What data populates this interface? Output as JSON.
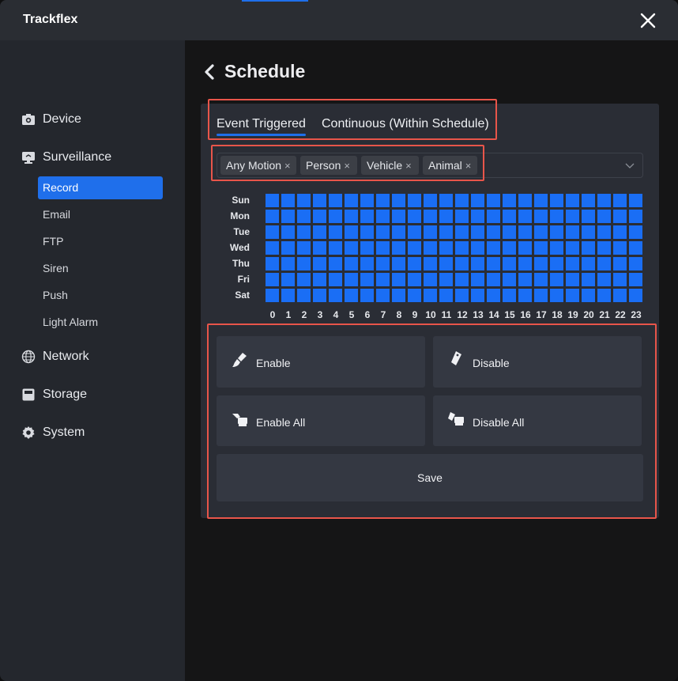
{
  "app": {
    "title": "Trackflex"
  },
  "sidebar": {
    "items": [
      {
        "label": "Device",
        "icon": "camera-icon"
      },
      {
        "label": "Surveillance",
        "icon": "monitor-icon"
      },
      {
        "label": "Network",
        "icon": "globe-icon"
      },
      {
        "label": "Storage",
        "icon": "storage-icon"
      },
      {
        "label": "System",
        "icon": "gear-icon"
      }
    ],
    "sub_items": [
      {
        "label": "Record",
        "active": true
      },
      {
        "label": "Email"
      },
      {
        "label": "FTP"
      },
      {
        "label": "Siren"
      },
      {
        "label": "Push"
      },
      {
        "label": "Light Alarm"
      }
    ]
  },
  "page": {
    "title": "Schedule"
  },
  "tabs": [
    {
      "label": "Event Triggered",
      "active": true
    },
    {
      "label": "Continuous (Within Schedule)"
    }
  ],
  "event_filter": {
    "selected": [
      "Any Motion",
      "Person",
      "Vehicle",
      "Animal"
    ],
    "remove_glyph": "×"
  },
  "schedule": {
    "days": [
      "Sun",
      "Mon",
      "Tue",
      "Wed",
      "Thu",
      "Fri",
      "Sat"
    ],
    "hours": [
      "0",
      "1",
      "2",
      "3",
      "4",
      "5",
      "6",
      "7",
      "8",
      "9",
      "10",
      "11",
      "12",
      "13",
      "14",
      "15",
      "16",
      "17",
      "18",
      "19",
      "20",
      "21",
      "22",
      "23"
    ],
    "all_enabled": true,
    "enabled_color": "#1a6ef5"
  },
  "actions": {
    "enable": "Enable",
    "disable": "Disable",
    "enable_all": "Enable All",
    "disable_all": "Disable All",
    "save": "Save"
  },
  "colors": {
    "accent": "#1f6feb",
    "highlight": "#e8554a"
  }
}
